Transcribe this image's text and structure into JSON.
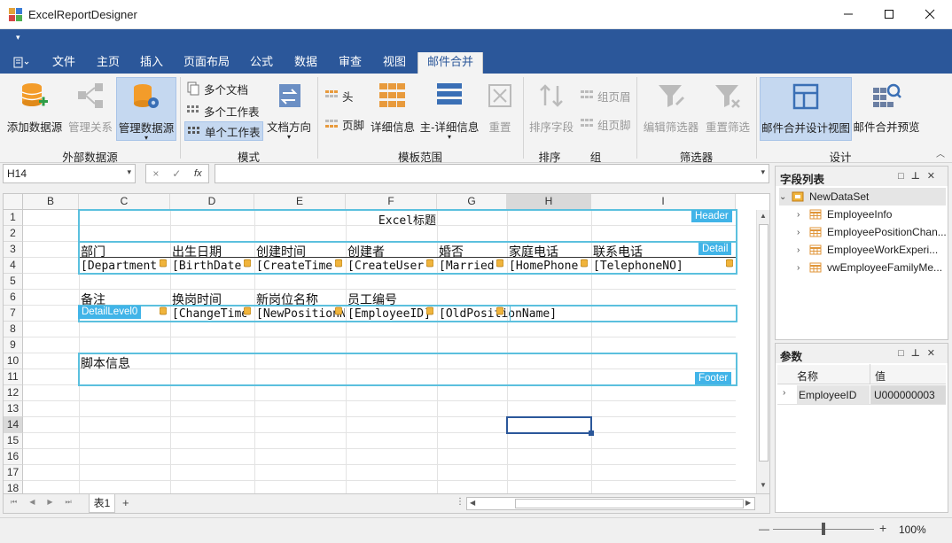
{
  "window": {
    "title": "ExcelReportDesigner",
    "minimize_icon": "minimize-icon",
    "maximize_icon": "maximize-icon",
    "close_icon": "close-icon"
  },
  "tabs": [
    {
      "label": "文件"
    },
    {
      "label": "主页"
    },
    {
      "label": "插入"
    },
    {
      "label": "页面布局"
    },
    {
      "label": "公式"
    },
    {
      "label": "数据"
    },
    {
      "label": "审查"
    },
    {
      "label": "视图"
    },
    {
      "label": "邮件合并"
    }
  ],
  "ribbon": {
    "groups": {
      "external": "外部数据源",
      "mode": "模式",
      "template": "模板范围",
      "sort": "排序",
      "group": "组",
      "filter": "筛选器",
      "design": "设计"
    },
    "add_datasource": "添加数据源",
    "manage_relations": "管理关系",
    "manage_datasource": "管理数据源",
    "multi_doc": "多个文档",
    "multi_sheet": "多个工作表",
    "single_sheet": "单个工作表",
    "doc_direction": "文档方向",
    "header": "头",
    "footer": "页脚",
    "detail_info": "详细信息",
    "master_detail": "主-详细信息",
    "reset": "重置",
    "sort_field": "排序字段",
    "group_header": "组页眉",
    "group_footer": "组页脚",
    "edit_filter": "编辑筛选器",
    "reset_filter": "重置筛选",
    "mail_merge_design": "邮件合并设计视图",
    "mail_merge_preview": "邮件合并预览"
  },
  "formula": {
    "name_box": "H14",
    "cancel": "×",
    "confirm": "✓",
    "fx": "fx"
  },
  "sheet": {
    "columns": [
      "B",
      "C",
      "D",
      "E",
      "F",
      "G",
      "H",
      "I"
    ],
    "rows": [
      "1",
      "2",
      "3",
      "4",
      "5",
      "6",
      "7",
      "8",
      "9",
      "10",
      "11",
      "12",
      "13",
      "14",
      "15",
      "16",
      "17",
      "18"
    ],
    "title": "Excel标题",
    "headers_row3": [
      "部门",
      "出生日期",
      "创建时间",
      "创建者",
      "婚否",
      "家庭电话",
      "联系电话"
    ],
    "fields_row4": [
      "[Department",
      "[BirthDate",
      "[CreateTime",
      "[CreateUser",
      "[Married",
      "[HomePhone",
      "[TelephoneNO]"
    ],
    "headers_row6": [
      "备注",
      "换岗时间",
      "新岗位名称",
      "员工编号"
    ],
    "fields_row7": [
      "[ChangeTime",
      "[NewPositionN",
      "[EmployeeID]",
      "[OldPositionName]"
    ],
    "script_info": "脚本信息",
    "tag_header": "Header",
    "tag_detail": "Detail",
    "tag_detail_level0": "DetailLevel0",
    "tag_footer": "Footer",
    "sheet_tab": "表1",
    "add_sheet": "+"
  },
  "field_list": {
    "title": "字段列表",
    "root": "NewDataSet",
    "items": [
      "EmployeeInfo",
      "EmployeePositionChan...",
      "EmployeeWorkExperi...",
      "vwEmployeeFamilyMe..."
    ]
  },
  "params": {
    "title": "参数",
    "col_name": "名称",
    "col_value": "值",
    "rows": [
      {
        "name": "EmployeeID",
        "value": "U000000003"
      }
    ]
  },
  "status": {
    "zoom": "100%",
    "minus": "—",
    "plus": "+",
    "zoom_level": 0.5
  },
  "colors": {
    "accent": "#2b579a",
    "range_border": "#5bc0de",
    "range_tag": "#41b4e8"
  }
}
